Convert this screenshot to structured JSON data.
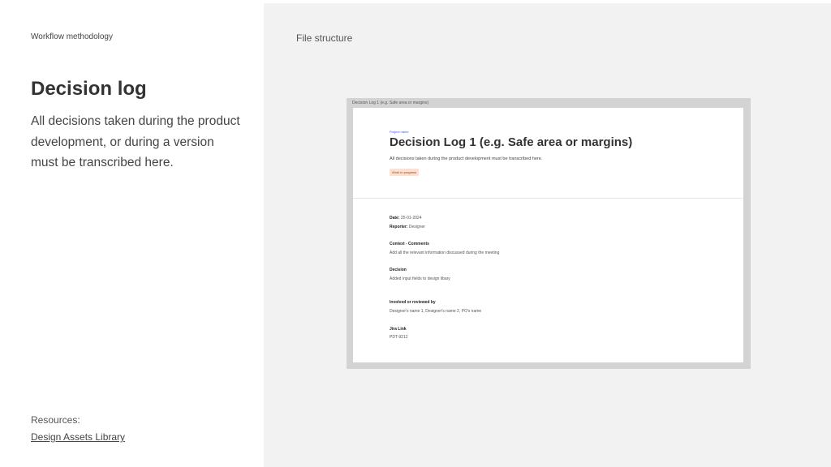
{
  "left": {
    "eyebrow": "Workflow methodology",
    "title": "Decision log",
    "description": "All decisions taken during the product development, or during a version must be transcribed here.",
    "resources_label": "Resources:",
    "resources_link": "Design Assets Library"
  },
  "right": {
    "section_title": "File structure",
    "frame_label": "Decision Log 1 (e.g. Safe area or margins)",
    "doc": {
      "project_name": "Project name",
      "title": "Decision Log 1 (e.g. Safe area or margins)",
      "subtitle": "All decisions taken during the product development must be transcribed here.",
      "status": "Work in progress",
      "date_label": "Date:",
      "date_value": "25-01-2024",
      "reporter_label": "Reporter:",
      "reporter_value": "Designer",
      "context_heading": "Context - Comments",
      "context_text": "Add all the relevant information discussed during the meeting",
      "decision_heading": "Decision",
      "decision_text": "Added input fields to design libary",
      "involved_heading": "Involved or reviewed by",
      "involved_text": "Designer's name 1, Designer's name 2, PO's name",
      "jira_heading": "Jira Link",
      "jira_text": "PDT-9212"
    }
  },
  "colors": {
    "panel_bg": "#f2f2f2",
    "frame_bg": "#d3d3d3",
    "badge_bg": "#fde0cf",
    "link_blue": "#3d5bd8"
  }
}
